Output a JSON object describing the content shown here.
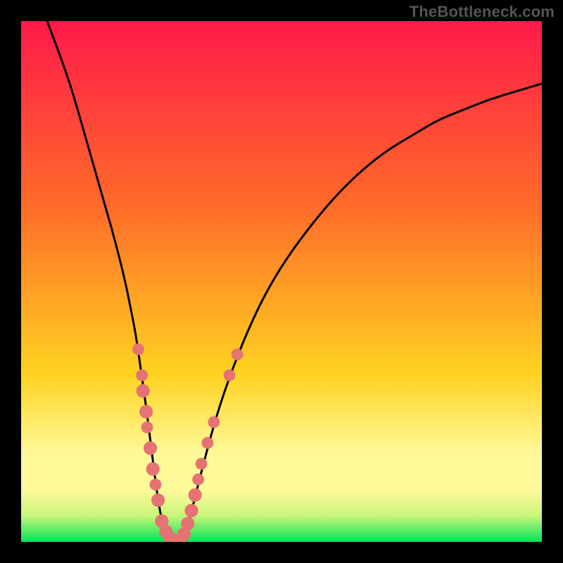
{
  "watermark": "TheBottleneck.com",
  "colors": {
    "frame": "#000000",
    "gradient_top": "#ff1a4a",
    "gradient_mid1": "#ff6a2a",
    "gradient_mid2": "#ffd321",
    "gradient_band": "#fff99a",
    "gradient_bottom": "#00e657",
    "curve": "#000000",
    "dot_fill": "#e57373",
    "dot_stroke": "#cc5a5a"
  },
  "chart_data": {
    "type": "line",
    "title": "",
    "xlabel": "",
    "ylabel": "",
    "x_range": [
      0,
      100
    ],
    "y_range": [
      0,
      100
    ],
    "curve": {
      "x": [
        5,
        8,
        10,
        12,
        14,
        16,
        18,
        20,
        21,
        22,
        23,
        24,
        25,
        26,
        27,
        28,
        29,
        30,
        31,
        32,
        33,
        35,
        38,
        42,
        46,
        50,
        55,
        60,
        65,
        70,
        75,
        80,
        85,
        90,
        95,
        100
      ],
      "y": [
        100,
        92,
        86,
        79,
        72,
        65,
        58,
        50,
        45,
        40,
        33,
        26,
        18,
        10,
        4,
        1,
        0,
        0,
        1,
        3,
        7,
        15,
        26,
        37,
        46,
        53,
        60,
        66,
        71,
        75,
        78,
        81,
        83,
        85,
        86.5,
        88
      ]
    },
    "dots": [
      {
        "x": 22.5,
        "y": 37,
        "r": 1.4
      },
      {
        "x": 23.2,
        "y": 32,
        "r": 1.4
      },
      {
        "x": 23.4,
        "y": 29,
        "r": 1.6
      },
      {
        "x": 24.0,
        "y": 25,
        "r": 1.6
      },
      {
        "x": 24.2,
        "y": 22,
        "r": 1.4
      },
      {
        "x": 24.8,
        "y": 18,
        "r": 1.6
      },
      {
        "x": 25.3,
        "y": 14,
        "r": 1.6
      },
      {
        "x": 25.8,
        "y": 11,
        "r": 1.4
      },
      {
        "x": 26.3,
        "y": 8,
        "r": 1.6
      },
      {
        "x": 27.0,
        "y": 4,
        "r": 1.6
      },
      {
        "x": 27.8,
        "y": 2,
        "r": 1.6
      },
      {
        "x": 28.6,
        "y": 0.8,
        "r": 1.6
      },
      {
        "x": 29.5,
        "y": 0.3,
        "r": 1.6
      },
      {
        "x": 30.5,
        "y": 0.3,
        "r": 1.6
      },
      {
        "x": 31.3,
        "y": 1.5,
        "r": 1.6
      },
      {
        "x": 32.0,
        "y": 3.5,
        "r": 1.6
      },
      {
        "x": 32.7,
        "y": 6,
        "r": 1.6
      },
      {
        "x": 33.4,
        "y": 9,
        "r": 1.6
      },
      {
        "x": 34.0,
        "y": 12,
        "r": 1.4
      },
      {
        "x": 34.6,
        "y": 15,
        "r": 1.4
      },
      {
        "x": 35.8,
        "y": 19,
        "r": 1.4
      },
      {
        "x": 37.0,
        "y": 23,
        "r": 1.4
      },
      {
        "x": 40.0,
        "y": 32,
        "r": 1.4
      },
      {
        "x": 41.5,
        "y": 36,
        "r": 1.4
      }
    ],
    "green_band_y": 5,
    "pale_band_y": 17
  }
}
